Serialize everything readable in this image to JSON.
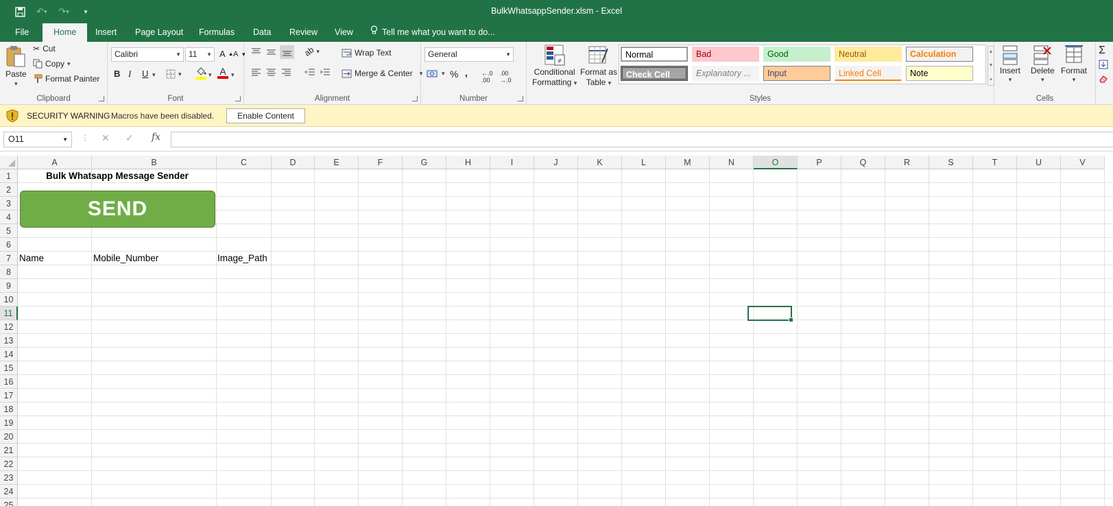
{
  "window": {
    "title": "BulkWhatsappSender.xlsm - Excel",
    "qat": {
      "save_icon": "save-icon",
      "undo_icon": "undo-icon",
      "redo_icon": "redo-icon",
      "customize_icon": "customize-qat-icon"
    }
  },
  "tabs": [
    {
      "label": "File"
    },
    {
      "label": "Home"
    },
    {
      "label": "Insert"
    },
    {
      "label": "Page Layout"
    },
    {
      "label": "Formulas"
    },
    {
      "label": "Data"
    },
    {
      "label": "Review"
    },
    {
      "label": "View"
    }
  ],
  "tell_me": "Tell me what you want to do...",
  "ribbon": {
    "clipboard": {
      "label": "Clipboard",
      "paste": "Paste",
      "cut": "Cut",
      "copy": "Copy",
      "format_painter": "Format Painter"
    },
    "font": {
      "label": "Font",
      "family": "Calibri",
      "size": "11",
      "bold": "B",
      "italic": "I",
      "underline": "U"
    },
    "alignment": {
      "label": "Alignment",
      "wrap_text": "Wrap Text",
      "merge_center": "Merge & Center"
    },
    "number": {
      "label": "Number",
      "format": "General",
      "percent": "%",
      "comma": ","
    },
    "styles": {
      "label": "Styles",
      "conditional_formatting_1": "Conditional",
      "conditional_formatting_2": "Formatting",
      "format_as_table_1": "Format as",
      "format_as_table_2": "Table",
      "cells": [
        {
          "name": "Normal",
          "bg": "#ffffff",
          "fg": "#000000"
        },
        {
          "name": "Bad",
          "bg": "#ffc7ce",
          "fg": "#9c0006"
        },
        {
          "name": "Good",
          "bg": "#c6efce",
          "fg": "#006100"
        },
        {
          "name": "Neutral",
          "bg": "#ffeb9c",
          "fg": "#9c5700"
        },
        {
          "name": "Calculation",
          "bg": "#f2f2f2",
          "fg": "#fa7d00"
        },
        {
          "name": "Check Cell",
          "bg": "#a5a5a5",
          "fg": "#ffffff"
        },
        {
          "name": "Explanatory ...",
          "bg": "#f3f3f3",
          "fg": "#7f7f7f"
        },
        {
          "name": "Input",
          "bg": "#ffcc99",
          "fg": "#3f3f76"
        },
        {
          "name": "Linked Cell",
          "bg": "#f3f3f3",
          "fg": "#fa7d00"
        },
        {
          "name": "Note",
          "bg": "#ffffcc",
          "fg": "#000000"
        }
      ]
    },
    "cells_group": {
      "label": "Cells",
      "insert": "Insert",
      "delete": "Delete",
      "format": "Format"
    }
  },
  "security": {
    "title": "SECURITY WARNING",
    "message": "Macros have been disabled.",
    "button": "Enable Content"
  },
  "formula_bar": {
    "name_box": "O11",
    "fx": "fx",
    "formula": ""
  },
  "sheet": {
    "columns": [
      "A",
      "B",
      "C",
      "D",
      "E",
      "F",
      "G",
      "H",
      "I",
      "J",
      "K",
      "L",
      "M",
      "N",
      "O",
      "P",
      "Q",
      "R",
      "S",
      "T",
      "U",
      "V"
    ],
    "rows": [
      "1",
      "2",
      "3",
      "4",
      "5",
      "6",
      "7",
      "8",
      "9",
      "10",
      "11",
      "12",
      "13",
      "14",
      "15",
      "16",
      "17",
      "18",
      "19",
      "20",
      "21",
      "22",
      "23",
      "24",
      "25"
    ],
    "selected_column": "O",
    "selected_row": "11",
    "title": "Bulk Whatsapp Message Sender",
    "send_button": "SEND",
    "headers": {
      "name": "Name",
      "mobile": "Mobile_Number",
      "image": "Image_Path"
    }
  },
  "colors": {
    "brand": "#217346",
    "send_button": "#70ad47",
    "warning_bar": "#fff4c4"
  }
}
